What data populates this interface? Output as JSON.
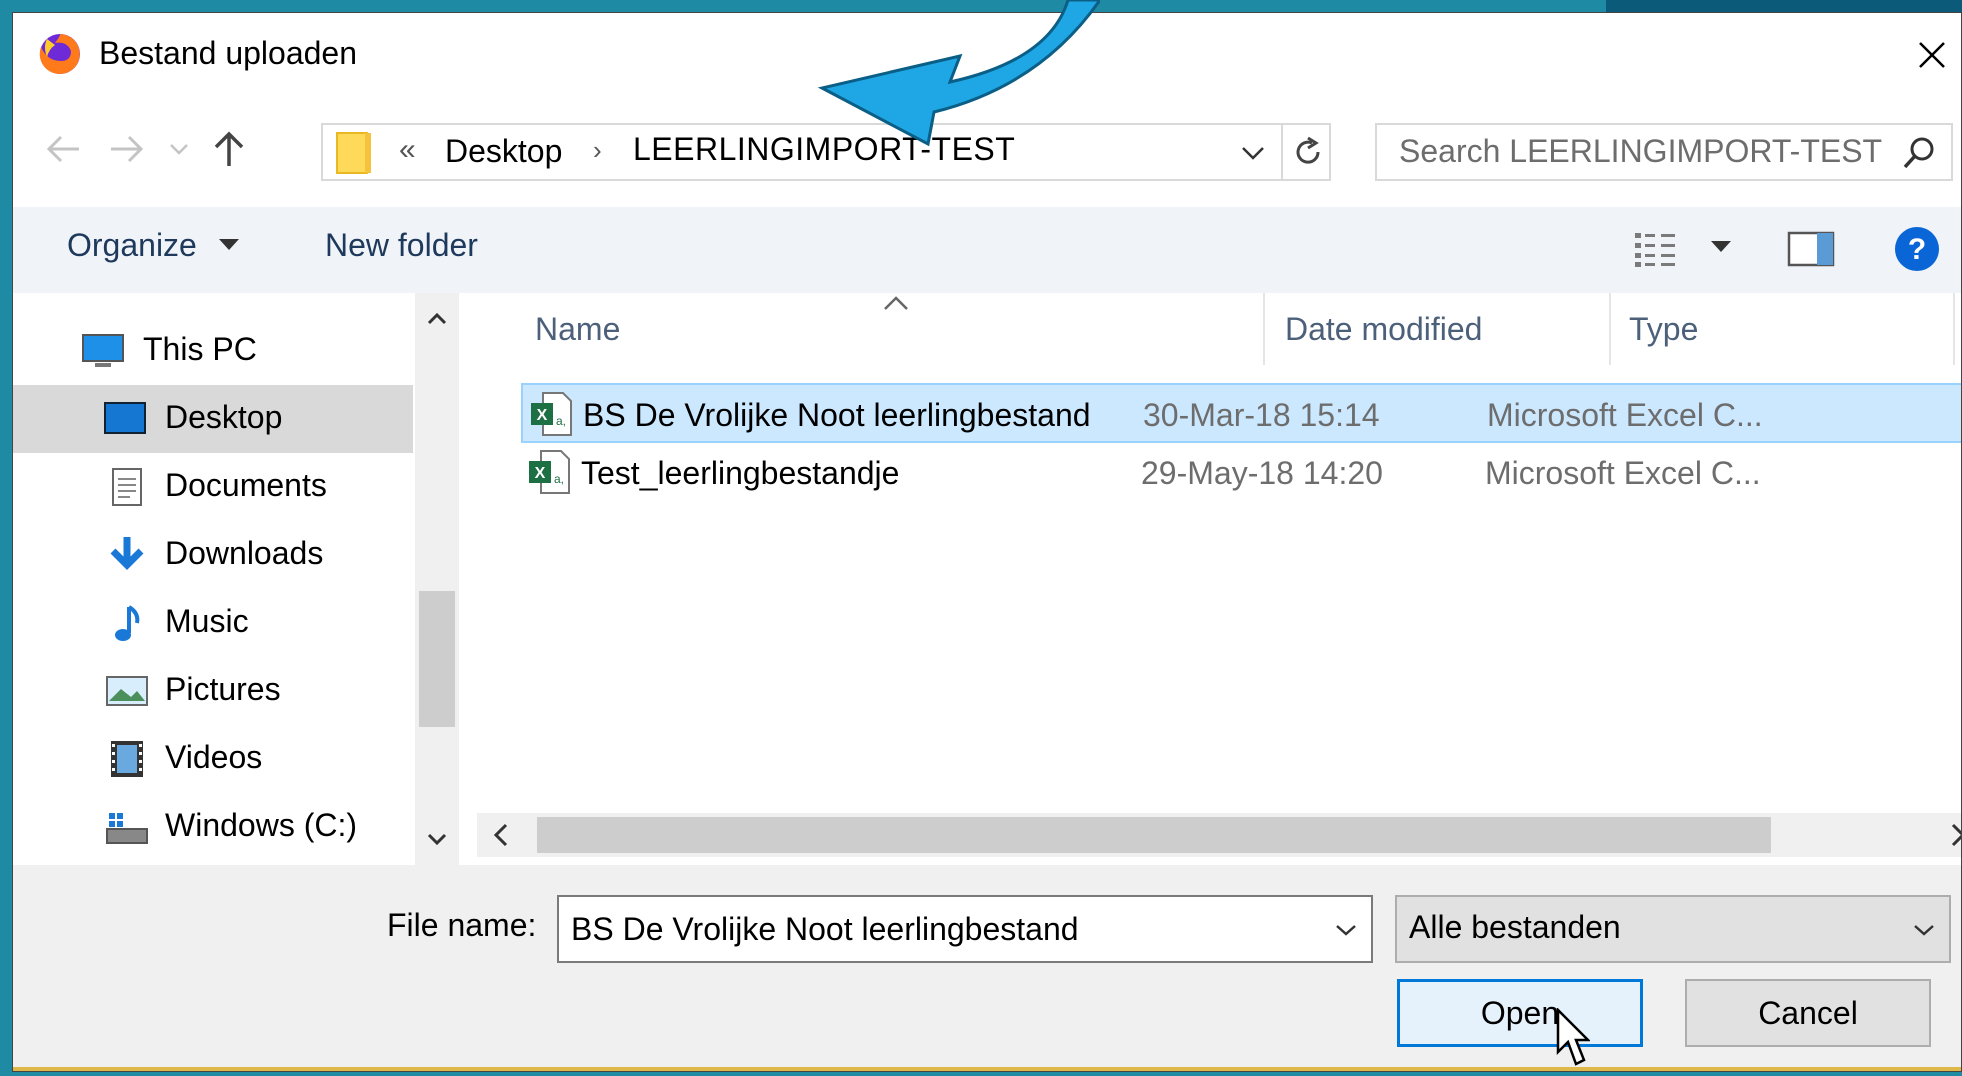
{
  "window": {
    "title": "Bestand uploaden",
    "app_icon": "firefox-icon",
    "close_icon": "close-icon"
  },
  "navigation": {
    "back_icon": "back-arrow-icon",
    "forward_icon": "forward-arrow-icon",
    "recent_icon": "recent-locations-chevron-icon",
    "up_icon": "up-arrow-icon"
  },
  "address": {
    "overflow": "«",
    "segments": [
      "Desktop",
      "LEERLINGIMPORT-TEST"
    ],
    "separator": "›",
    "refresh_icon": "refresh-icon"
  },
  "search": {
    "placeholder": "Search LEERLINGIMPORT-TEST"
  },
  "toolbar": {
    "organize_label": "Organize",
    "new_folder_label": "New folder",
    "view_icon": "details-view-icon",
    "preview_icon": "preview-pane-icon",
    "help_icon": "help-icon"
  },
  "nav_pane": {
    "items": [
      {
        "label": "This PC",
        "icon": "this-pc-icon"
      },
      {
        "label": "Desktop",
        "icon": "desktop-icon",
        "selected": true
      },
      {
        "label": "Documents",
        "icon": "documents-icon"
      },
      {
        "label": "Downloads",
        "icon": "downloads-icon"
      },
      {
        "label": "Music",
        "icon": "music-icon"
      },
      {
        "label": "Pictures",
        "icon": "pictures-icon"
      },
      {
        "label": "Videos",
        "icon": "videos-icon"
      },
      {
        "label": "Windows (C:)",
        "icon": "drive-icon"
      }
    ]
  },
  "file_list": {
    "columns": [
      "Name",
      "Date modified",
      "Type"
    ],
    "rows": [
      {
        "name": "BS De Vrolijke Noot leerlingbestand",
        "date": "30-Mar-18 15:14",
        "type": "Microsoft Excel C...",
        "selected": true
      },
      {
        "name": "Test_leerlingbestandje",
        "date": "29-May-18 14:20",
        "type": "Microsoft Excel C..."
      }
    ]
  },
  "bottom": {
    "file_name_label": "File name:",
    "file_name_value": "BS De Vrolijke Noot leerlingbestand",
    "filter_value": "Alle bestanden",
    "open_label": "Open",
    "cancel_label": "Cancel"
  },
  "colors": {
    "accent": "#0078d7",
    "selection": "#cce8ff",
    "annotation_arrow": "#1ea7e4"
  }
}
